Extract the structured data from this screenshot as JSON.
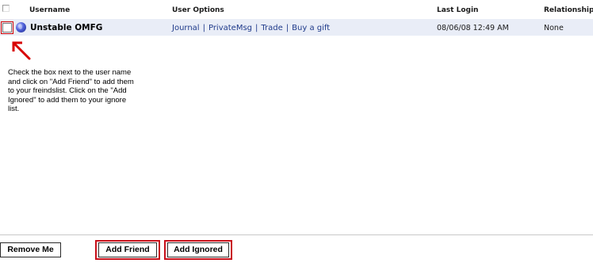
{
  "table": {
    "headers": {
      "username": "Username",
      "user_options": "User Options",
      "last_login": "Last Login",
      "relationship": "Relationship"
    },
    "rows": [
      {
        "username": "Unstable OMFG",
        "options": [
          "Journal",
          "PrivateMsg",
          "Trade",
          "Buy a gift"
        ],
        "last_login": "08/06/08 12:49 AM",
        "relationship": "None"
      }
    ]
  },
  "hint_text": "Check the box next to the user name and click on \"Add Friend\" to add them to your freindslist.  Click on the \"Add Ignored\" to add them to your ignore list.",
  "buttons": {
    "remove_me": "Remove Me",
    "add_friend": "Add Friend",
    "add_ignored": "Add Ignored"
  },
  "colors": {
    "row_background": "#e9edf7",
    "link": "#1f3a8a",
    "highlight_red": "#c8101a"
  },
  "icons": {
    "row_status": "globe-icon",
    "annotation": "red-arrow-icon"
  }
}
